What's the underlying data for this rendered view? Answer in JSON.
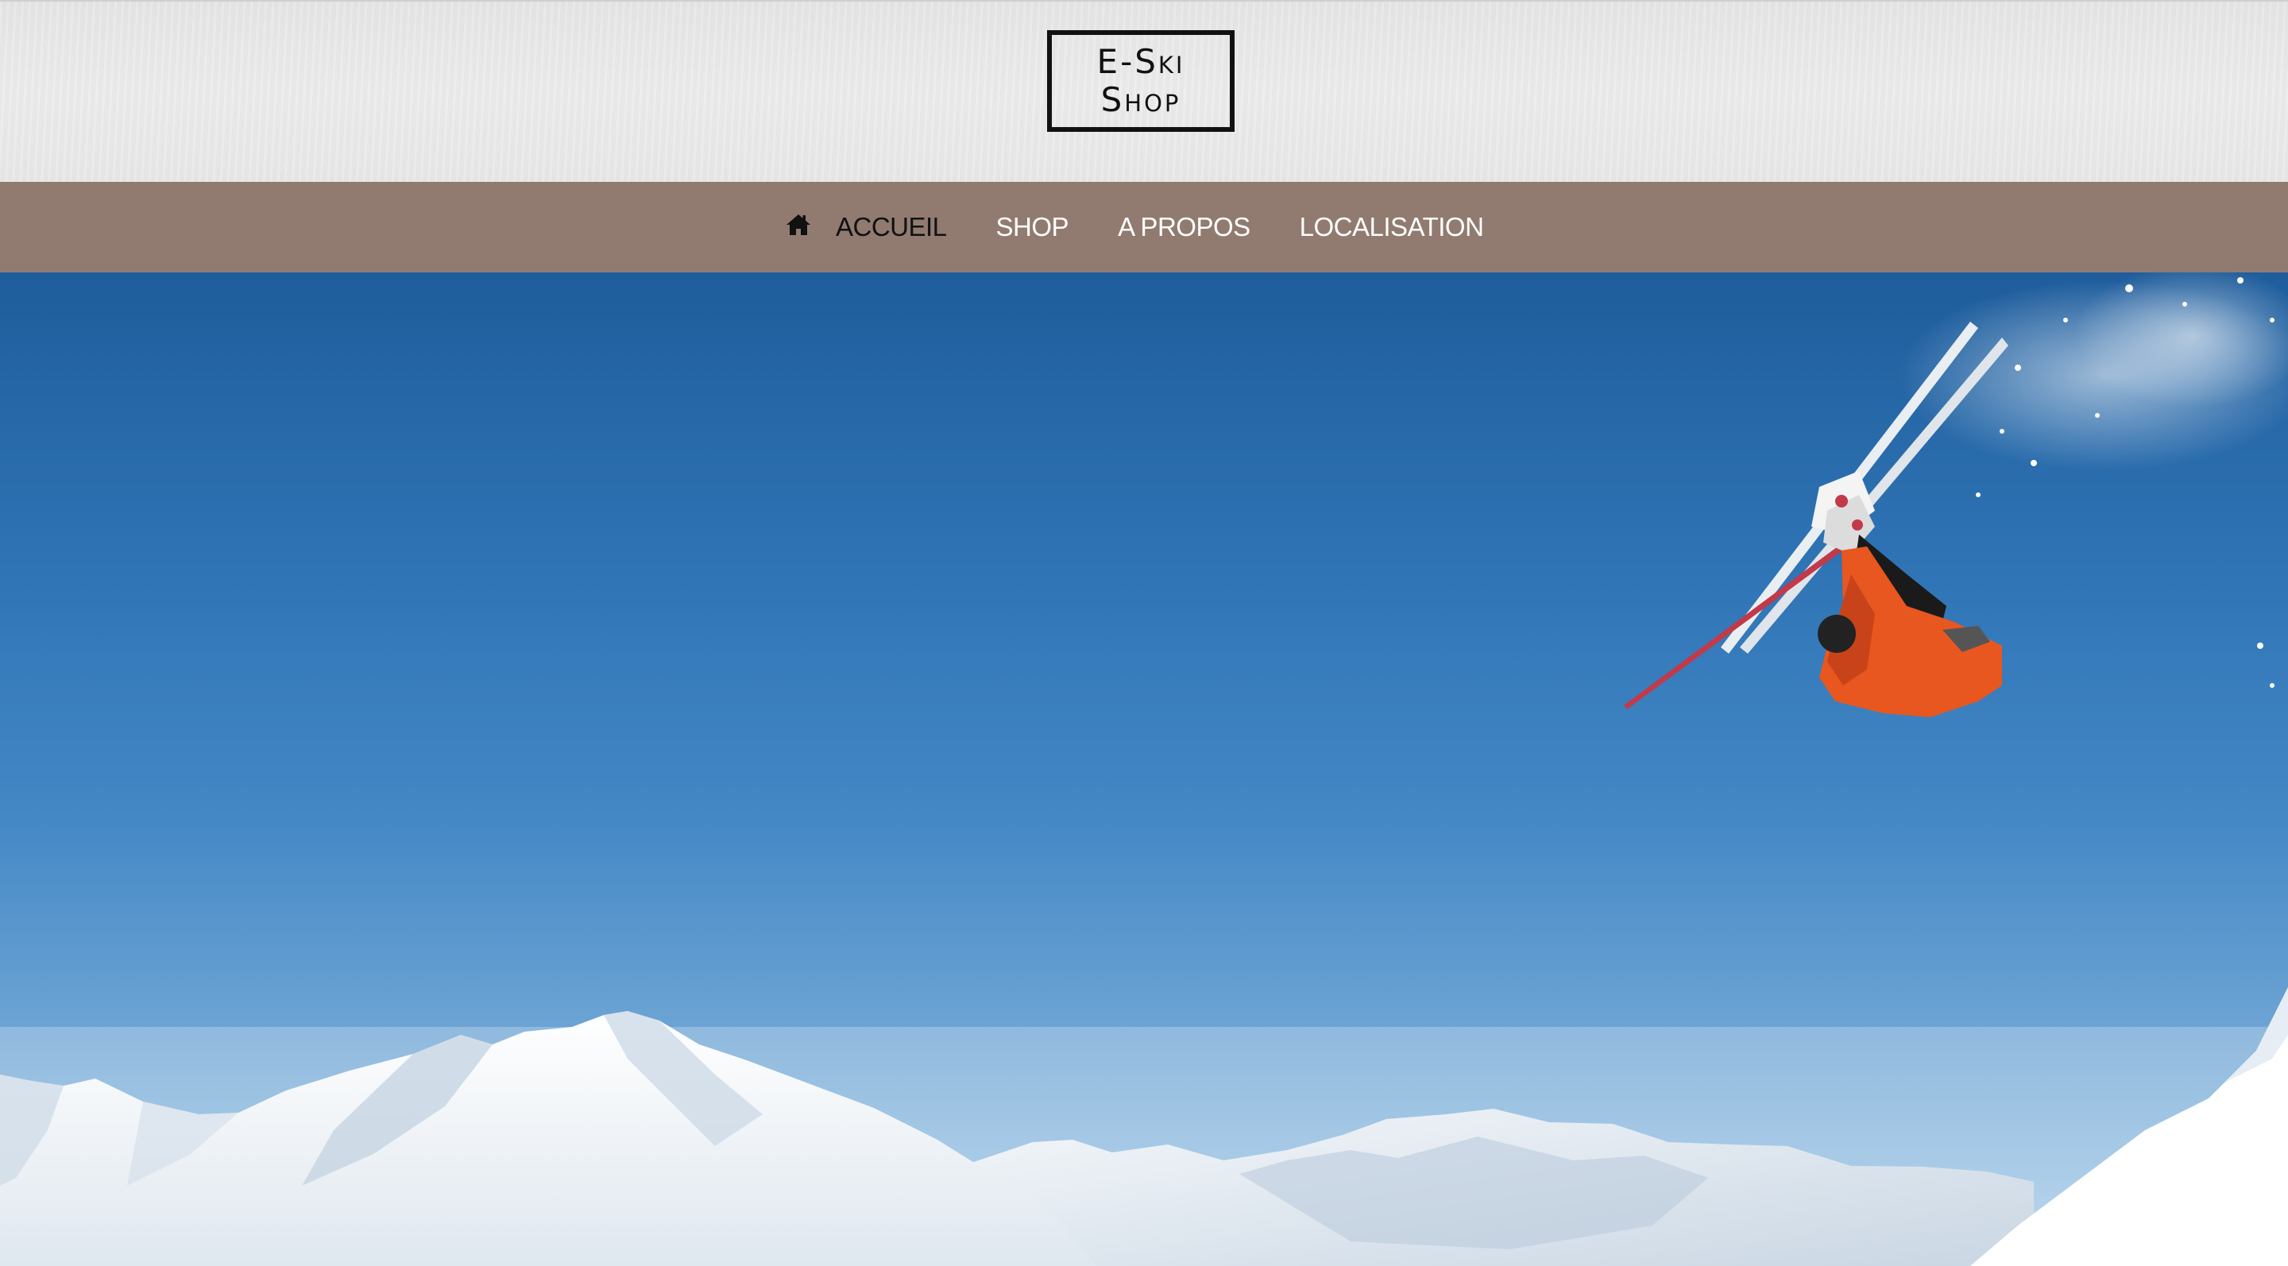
{
  "logo": {
    "line1": "E-Ski",
    "line2": "Shop"
  },
  "nav": {
    "home_icon": "home-icon",
    "items": [
      {
        "label": "ACCUEIL",
        "active": true
      },
      {
        "label": "SHOP",
        "active": false
      },
      {
        "label": "A PROPOS",
        "active": false
      },
      {
        "label": "LOCALISATION",
        "active": false
      }
    ]
  },
  "hero": {
    "image": "skier-backflip-over-snowy-mountains"
  },
  "colors": {
    "navbar": "#917b70",
    "header_bg": "#e9e9e9",
    "sky_top": "#1f5d9c",
    "sky_bottom": "#b7d4ec",
    "jacket": "#e8571f"
  }
}
